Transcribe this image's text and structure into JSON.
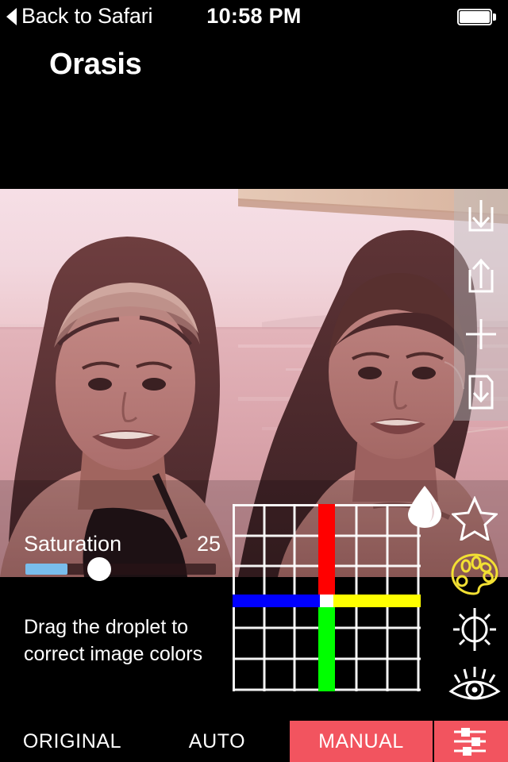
{
  "status_bar": {
    "back_label": "Back to Safari",
    "back_icon": "triangle-left-icon",
    "time": "10:58 PM",
    "battery_icon": "battery-full-icon"
  },
  "header": {
    "app_title": "Orasis"
  },
  "photo_toolbar": {
    "items": [
      {
        "name": "download-button",
        "icon": "download-tray-icon"
      },
      {
        "name": "share-button",
        "icon": "share-up-icon"
      },
      {
        "name": "add-button",
        "icon": "plus-icon"
      },
      {
        "name": "save-as-button",
        "icon": "save-document-icon"
      }
    ]
  },
  "editor": {
    "droplet_icon": "droplet-icon",
    "hint": "Drag the droplet to correct image colors",
    "slider": {
      "label": "Saturation",
      "value": "25",
      "fill_percent": 22,
      "fill_color": "#79bdec",
      "thumb_color": "#ffffff"
    },
    "color_grid": {
      "rows": 6,
      "cols": 6,
      "line_color": "#ffffff",
      "axis_up_color": "#ff0000",
      "axis_down_color": "#00ff00",
      "axis_left_color": "#0000ff",
      "axis_right_color": "#ffff00",
      "center_color": "#ffffff"
    }
  },
  "right_rail": {
    "items": [
      {
        "name": "favorite-tool",
        "icon": "star-icon",
        "color": "#ffffff",
        "active": false
      },
      {
        "name": "color-tool",
        "icon": "palette-icon",
        "color": "#f2e033",
        "active": true
      },
      {
        "name": "exposure-tool",
        "icon": "brightness-icon",
        "color": "#ffffff",
        "active": false
      },
      {
        "name": "detail-tool",
        "icon": "eye-icon",
        "color": "#ffffff",
        "active": false
      }
    ]
  },
  "tab_bar": {
    "accent_color": "#f2545f",
    "tabs": [
      {
        "name": "tab-original",
        "label": "ORIGINAL",
        "active": false
      },
      {
        "name": "tab-auto",
        "label": "AUTO",
        "active": false
      },
      {
        "name": "tab-manual",
        "label": "MANUAL",
        "active": true
      }
    ],
    "sliders_button": {
      "name": "tab-sliders",
      "icon": "sliders-icon",
      "active": true
    }
  }
}
